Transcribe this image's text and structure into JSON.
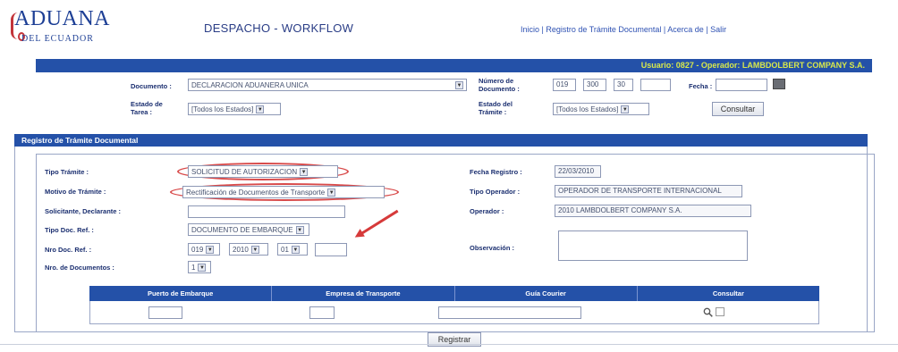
{
  "header": {
    "logo_title": "ADUANA",
    "logo_subtitle": "DEL ECUADOR",
    "app_title": "DESPACHO - WORKFLOW",
    "links": [
      "Inicio",
      "Registro de Trámite Documental",
      "Acerca de",
      "Salir"
    ]
  },
  "user_bar": {
    "text": "Usuario: 0827 - Operador: LAMBDOLBERT COMPANY S.A."
  },
  "search": {
    "documento_label": "Documento :",
    "documento_value": "DECLARACION ADUANERA UNICA",
    "numero_label": "Número de Documento :",
    "numero_parts": [
      "019",
      "300",
      "30"
    ],
    "numero_last": "",
    "fecha_label": "Fecha :",
    "fecha_value": "",
    "estado_tarea_label": "Estado de Tarea :",
    "estado_tarea_value": "[Todos los Estados]",
    "estado_tramite_label": "Estado del Trámite :",
    "estado_tramite_value": "[Todos los Estados]",
    "consultar_button": "Consultar"
  },
  "section": {
    "title": "Registro de Trámite Documental"
  },
  "form": {
    "tipo_tramite_label": "Tipo Trámite :",
    "tipo_tramite_value": "SOLICITUD DE AUTORIZACION",
    "motivo_label": "Motivo de Trámite :",
    "motivo_value": "Rectificación de Documentos de Transporte",
    "solicitante_label": "Solicitante, Declarante :",
    "solicitante_value": "",
    "tipo_doc_label": "Tipo Doc. Ref. :",
    "tipo_doc_value": "DOCUMENTO DE EMBARQUE",
    "nro_doc_label": "Nro Doc. Ref. :",
    "nro_doc_parts": [
      "019",
      "2010",
      "01"
    ],
    "nro_doc_last": "",
    "nro_documentos_label": "Nro. de Documentos :",
    "nro_documentos_value": "1",
    "fecha_registro_label": "Fecha Registro :",
    "fecha_registro_value": "22/03/2010",
    "tipo_operador_label": "Tipo Operador :",
    "tipo_operador_value": "OPERADOR DE TRANSPORTE INTERNACIONAL",
    "operador_label": "Operador :",
    "operador_value": "2010 LAMBDOLBERT COMPANY S.A.",
    "observacion_label": "Observación :",
    "observacion_value": ""
  },
  "grid": {
    "columns": [
      "Puerto de Embarque",
      "Empresa de Transporte",
      "Guía Courier",
      "Consultar"
    ]
  },
  "footer": {
    "registrar_button": "Registrar"
  }
}
